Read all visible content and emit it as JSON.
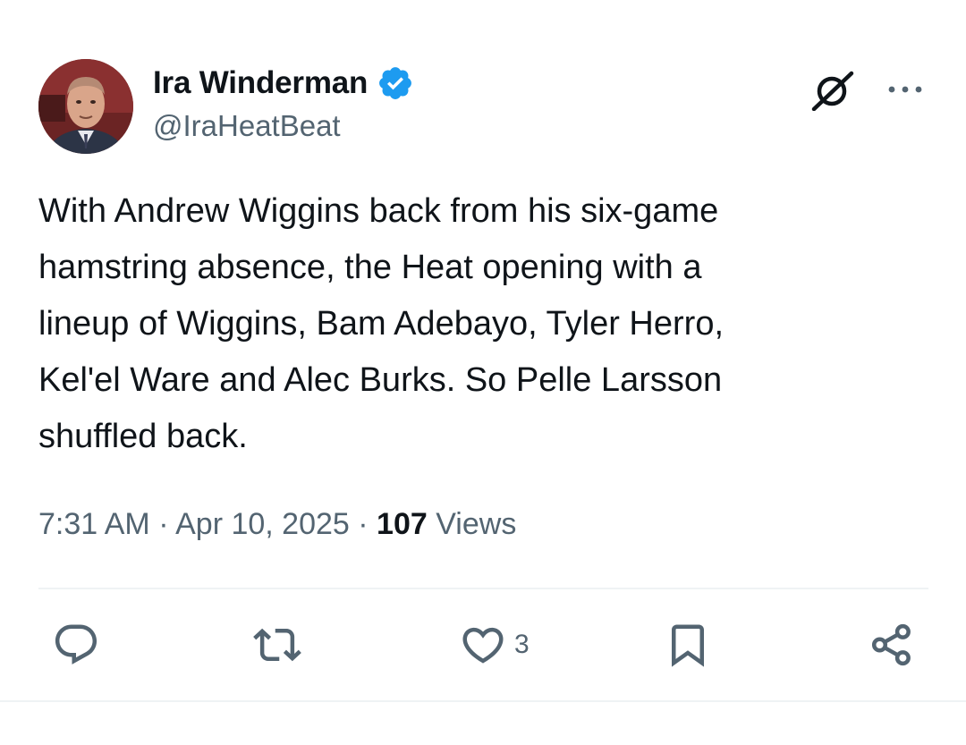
{
  "author": {
    "display_name": "Ira Winderman",
    "handle": "@IraHeatBeat",
    "verified_icon": "verified-badge-icon",
    "verified_color": "#1d9bf0"
  },
  "header_icons": [
    "grok-icon",
    "more-icon"
  ],
  "tweet": {
    "text": "With Andrew Wiggins back from his six-game\nhamstring absence, the Heat opening with a\nlineup of Wiggins, Bam Adebayo, Tyler Herro,\nKel'el Ware and Alec Burks. So Pelle Larsson\nshuffled back.",
    "time": "7:31 AM",
    "separator": "·",
    "date": "Apr 10, 2025",
    "views_count": "107",
    "views_label": "Views"
  },
  "actions": {
    "reply": {
      "icon": "reply-icon"
    },
    "retweet": {
      "icon": "retweet-icon"
    },
    "like": {
      "icon": "heart-icon",
      "count": "3"
    },
    "bookmark": {
      "icon": "bookmark-icon"
    },
    "share": {
      "icon": "share-icon"
    }
  },
  "colors": {
    "text_primary": "#0f1419",
    "text_secondary": "#536471",
    "accent": "#1d9bf0",
    "divider": "#eff3f4"
  }
}
